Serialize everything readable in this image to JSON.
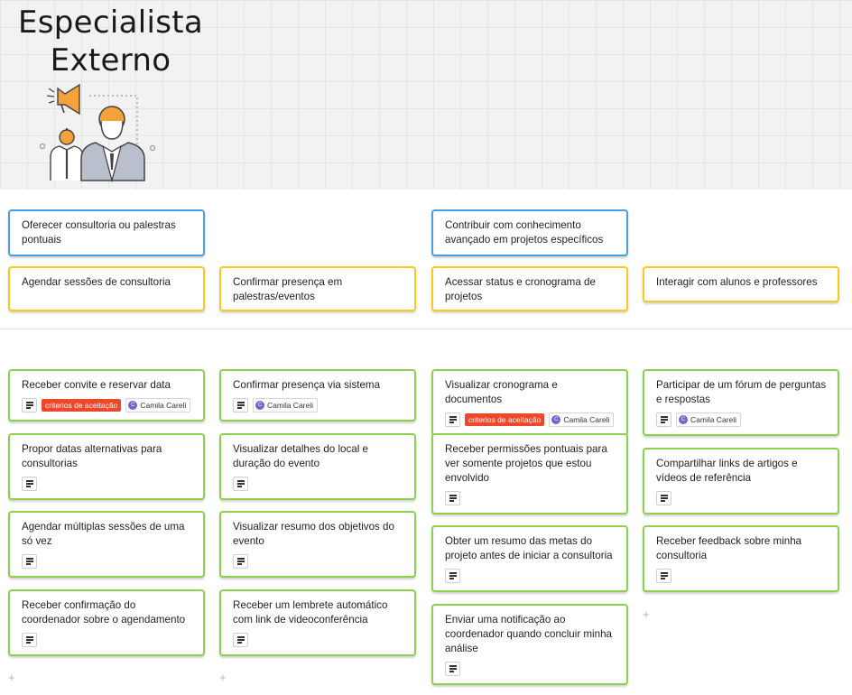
{
  "title_line1": "Especialista",
  "title_line2": "Externo",
  "goals": [
    {
      "text": "Oferecer consultoria ou palestras pontuais"
    },
    {
      "text": "Contribuir com conhecimento avançado em projetos específicos"
    }
  ],
  "activities": [
    {
      "text": "Agendar sessões de consultoria"
    },
    {
      "text": "Confirmar presença em palestras/eventos"
    },
    {
      "text": "Acessar status e cronograma de projetos"
    },
    {
      "text": "Interagir com alunos e professores"
    }
  ],
  "stories": {
    "col1": [
      {
        "text": "Receber convite e reservar data",
        "tag": "criterios de aceitação",
        "user": "Camila Careli",
        "avatar": "C"
      },
      {
        "text": "Propor datas alternativas para consultorias"
      },
      {
        "text": "Agendar múltiplas sessões de uma só vez"
      },
      {
        "text": "Receber confirmação do coordenador sobre o agendamento"
      }
    ],
    "col2": [
      {
        "text": "Confirmar presença via sistema",
        "user": "Camila Careli",
        "avatar": "C"
      },
      {
        "text": "Visualizar detalhes do local e duração do evento"
      },
      {
        "text": "Visualizar resumo dos objetivos do evento"
      },
      {
        "text": "Receber um lembrete automático com link de videoconferência"
      }
    ],
    "col3": [
      {
        "text": "Visualizar cronograma e documentos",
        "tag": "criterios de aceitação",
        "user": "Camila Careli",
        "avatar": "C"
      },
      {
        "text": "Receber permissões pontuais para ver somente projetos que estou envolvido"
      },
      {
        "text": "Obter um resumo das metas do projeto antes de iniciar a consultoria"
      },
      {
        "text": "Enviar uma notificação ao coordenador quando concluir minha análise"
      }
    ],
    "col4": [
      {
        "text": "Participar de um fórum de perguntas e respostas",
        "user": "Camila Careli",
        "avatar": "C"
      },
      {
        "text": "Compartilhar links de artigos e vídeos de referência"
      },
      {
        "text": "Receber feedback sobre minha consultoria"
      }
    ]
  },
  "add_symbol": "+",
  "colors": {
    "goal_border": "#4a9fe0",
    "activity_border": "#f5cc1c",
    "story_border": "#8cd14e",
    "tag_bg": "#f0462a",
    "avatar_bg": "#7b61c9"
  },
  "icons": {
    "persona": "megaphone-people-illustration",
    "description": "description-lines-icon"
  }
}
